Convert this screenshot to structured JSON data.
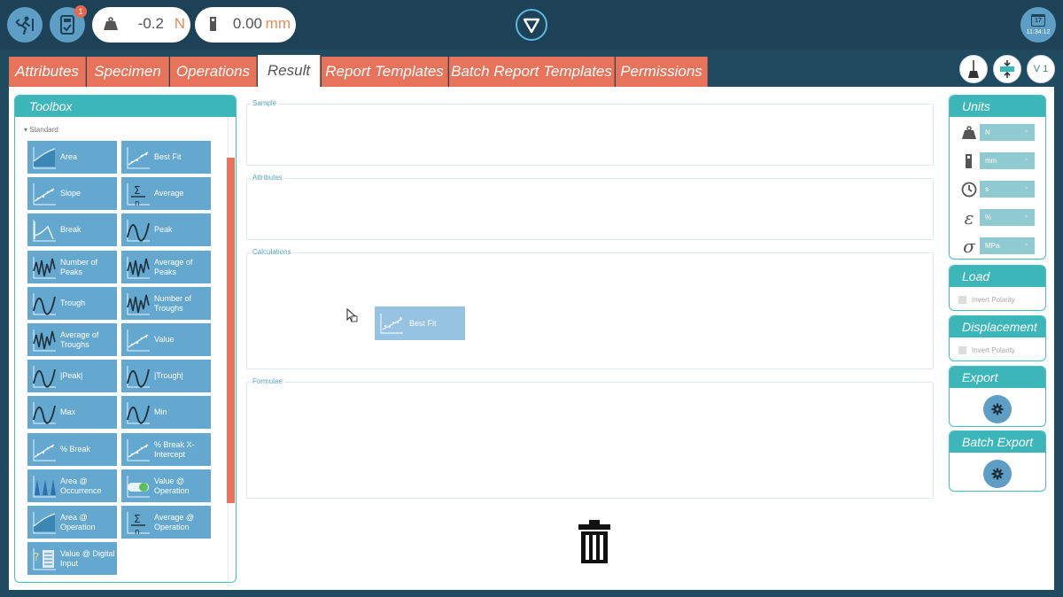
{
  "topbar": {
    "notification_count": "1",
    "force": {
      "value": "-0.2",
      "unit": "N"
    },
    "displacement": {
      "value": "0.00",
      "unit": "mm"
    },
    "clock": {
      "day": "17",
      "time": "11:34:12"
    }
  },
  "tabs": [
    {
      "label": "Attributes"
    },
    {
      "label": "Specimen"
    },
    {
      "label": "Operations"
    },
    {
      "label": "Result"
    },
    {
      "label": "Report Templates"
    },
    {
      "label": "Batch Report Templates"
    },
    {
      "label": "Permissions"
    }
  ],
  "version_label": "V 1",
  "toolbox": {
    "title": "Toolbox",
    "group_label": "Standard",
    "tools": [
      {
        "label": "Area"
      },
      {
        "label": "Best Fit"
      },
      {
        "label": "Slope"
      },
      {
        "label": "Average"
      },
      {
        "label": "Break"
      },
      {
        "label": "Peak"
      },
      {
        "label": "Number of Peaks"
      },
      {
        "label": "Average of Peaks"
      },
      {
        "label": "Trough"
      },
      {
        "label": "Number of Troughs"
      },
      {
        "label": "Average of Troughs"
      },
      {
        "label": "Value"
      },
      {
        "label": "|Peak|"
      },
      {
        "label": "|Trough|"
      },
      {
        "label": "Max"
      },
      {
        "label": "Min"
      },
      {
        "label": "% Break"
      },
      {
        "label": "% Break X-Intercept"
      },
      {
        "label": "Area @ Occurrence"
      },
      {
        "label": "Value @ Operation"
      },
      {
        "label": "Area @ Operation"
      },
      {
        "label": "Average @ Operation"
      },
      {
        "label": "Value @ Digital Input"
      }
    ]
  },
  "sections": {
    "sample": "Sample",
    "attributes": "Attributes",
    "calculations": "Calculations",
    "formulae": "Formulae"
  },
  "dragged_item": {
    "label": "Best Fit"
  },
  "units": {
    "title": "Units",
    "rows": [
      {
        "icon": "weight-icon",
        "value": "N"
      },
      {
        "icon": "length-icon",
        "value": "mm"
      },
      {
        "icon": "clock-icon",
        "value": "s"
      },
      {
        "icon": "strain-icon",
        "symbol": "ε",
        "value": "%"
      },
      {
        "icon": "stress-icon",
        "symbol": "σ",
        "value": "MPa"
      }
    ]
  },
  "load": {
    "title": "Load",
    "invert_label": "Invert Polarity"
  },
  "displacement_panel": {
    "title": "Displacement",
    "invert_label": "Invert Polarity"
  },
  "export": {
    "title": "Export"
  },
  "batch_export": {
    "title": "Batch Export"
  },
  "colors": {
    "accent": "#3cb6b8",
    "tab": "#e6735a",
    "tool": "#64a8d0",
    "header": "#1d4258"
  }
}
